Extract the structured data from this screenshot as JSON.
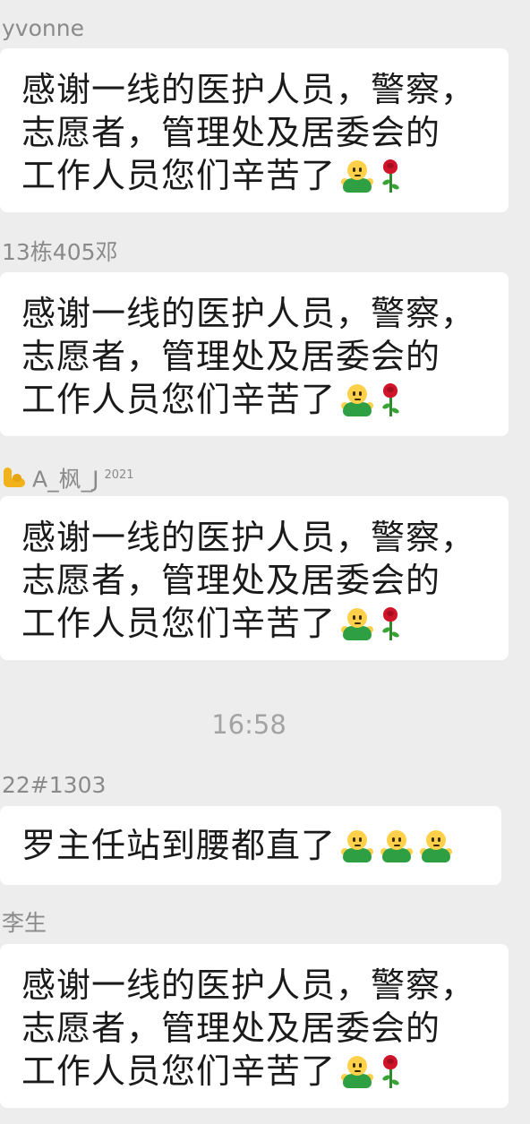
{
  "messages": [
    {
      "sender": "yvonne",
      "lines": [
        "感谢一线的医护人员，警察，",
        "志愿者，管理处及居委会的",
        "工作人员您们辛苦了"
      ]
    },
    {
      "sender": "13栋405邓",
      "lines": [
        "感谢一线的医护人员，警察，",
        "志愿者，管理处及居委会的",
        "工作人员您们辛苦了"
      ]
    },
    {
      "sender": "A_枫_J",
      "sender_badge": "2021",
      "sender_icon": "flexed-biceps-icon",
      "lines": [
        "感谢一线的医护人员，警察，",
        "志愿者，管理处及居委会的",
        "工作人员您们辛苦了"
      ]
    },
    {
      "sender": "22#1303",
      "lines": [
        "罗主任站到腰都直了"
      ]
    },
    {
      "sender": "李生",
      "lines": [
        "感谢一线的医护人员，警察，",
        "志愿者，管理处及居委会的",
        "工作人员您们辛苦了"
      ]
    }
  ],
  "timestamp": "16:58",
  "icons": {
    "face": "bowing-person-icon",
    "rose": "rose-icon"
  },
  "colors": {
    "background": "#ededed",
    "bubble": "#ffffff",
    "sender_text": "#8a8a8a",
    "timestamp_text": "#a3a3a3"
  }
}
